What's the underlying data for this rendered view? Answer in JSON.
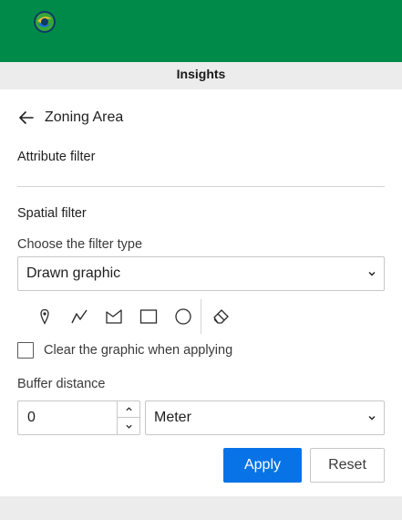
{
  "app": {
    "title": "Insights",
    "logo_icon": "green-globe-logo-icon",
    "header_color": "#008a4a"
  },
  "panel": {
    "back_icon": "arrow-left-icon",
    "title": "Zoning Area",
    "attribute_filter_label": "Attribute filter",
    "spatial_filter_label": "Spatial filter",
    "filter_type_label": "Choose the filter type",
    "filter_type_value": "Drawn graphic",
    "drawing_tools": [
      {
        "name": "point-tool",
        "icon": "map-pin-icon"
      },
      {
        "name": "polyline-tool",
        "icon": "polyline-icon"
      },
      {
        "name": "polygon-tool",
        "icon": "polygon-icon"
      },
      {
        "name": "rectangle-tool",
        "icon": "rectangle-icon"
      },
      {
        "name": "circle-tool",
        "icon": "circle-icon"
      },
      {
        "name": "eraser-tool",
        "icon": "eraser-icon"
      }
    ],
    "clear_graphic_label": "Clear the graphic when applying",
    "clear_graphic_checked": false,
    "buffer_distance_label": "Buffer distance",
    "buffer_distance_value": "0",
    "buffer_unit_value": "Meter",
    "apply_label": "Apply",
    "reset_label": "Reset",
    "accent_color": "#0773e6"
  }
}
